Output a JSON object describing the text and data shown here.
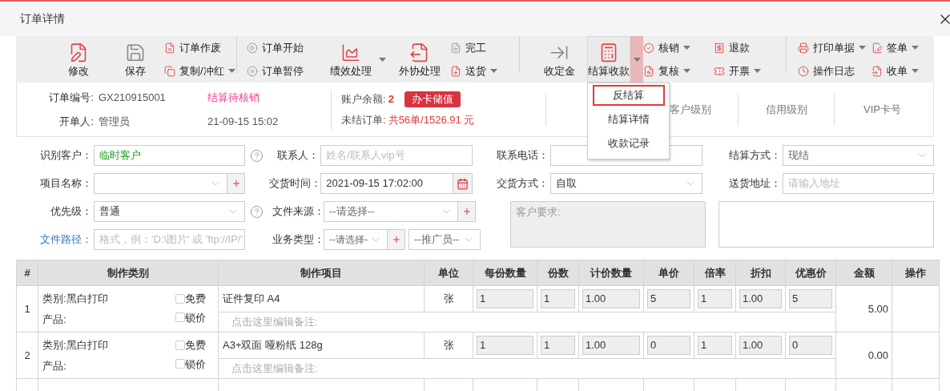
{
  "window": {
    "title": "订单详情"
  },
  "toolbar": {
    "groups": [
      {
        "items": [
          {
            "kind": "large",
            "label": "修改",
            "has_menu": false,
            "pressed": false
          },
          {
            "kind": "large",
            "label": "保存",
            "has_menu": false,
            "pressed": false
          },
          {
            "kind": "stack",
            "items": [
              {
                "label": "订单作废",
                "has_menu": false
              },
              {
                "label": "复制/冲红",
                "has_menu": true
              }
            ]
          }
        ]
      },
      {
        "items": [
          {
            "kind": "stack",
            "items": [
              {
                "label": "订单开始",
                "has_menu": false
              },
              {
                "label": "订单暂停",
                "has_menu": false
              }
            ]
          },
          {
            "kind": "large",
            "label": "绩效处理",
            "has_menu": true,
            "pressed": false
          },
          {
            "kind": "large",
            "label": "外协处理",
            "has_menu": false,
            "pressed": false
          },
          {
            "kind": "stack",
            "items": [
              {
                "label": "完工",
                "has_menu": false
              },
              {
                "label": "送货",
                "has_menu": true
              }
            ]
          }
        ]
      },
      {
        "items": [
          {
            "kind": "large",
            "label": "收定金",
            "has_menu": false,
            "pressed": false
          },
          {
            "kind": "large",
            "label": "结算收款",
            "has_menu": true,
            "pressed": true
          },
          {
            "kind": "stack",
            "items": [
              {
                "label": "核销",
                "has_menu": true
              },
              {
                "label": "复核",
                "has_menu": true
              }
            ]
          },
          {
            "kind": "stack",
            "items": [
              {
                "label": "退款",
                "has_menu": false
              },
              {
                "label": "开票",
                "has_menu": true
              }
            ]
          }
        ]
      },
      {
        "items": [
          {
            "kind": "stack",
            "items": [
              {
                "label": "打印单据",
                "has_menu": true
              },
              {
                "label": "操作日志",
                "has_menu": false
              }
            ]
          },
          {
            "kind": "stack",
            "items": [
              {
                "label": "签单",
                "has_menu": true
              },
              {
                "label": "收单",
                "has_menu": true
              }
            ]
          }
        ]
      }
    ]
  },
  "menu": {
    "items": [
      {
        "label": "反结算",
        "selected": true
      },
      {
        "label": "结算详情",
        "selected": false
      },
      {
        "label": "收款记录",
        "selected": false
      }
    ]
  },
  "info": {
    "order_no": {
      "label": "订单编号:",
      "value": "GX210915001"
    },
    "status": "结算待核销",
    "creator": {
      "label": "开单人:",
      "value": "管理员"
    },
    "created": "21-09-15 15:02",
    "balance": {
      "label": "账户余额:",
      "value": "2"
    },
    "recharge_button": "办卡储值",
    "unpaid": {
      "label": "未结订单:",
      "value": "共56单/1526.91 元"
    },
    "columns": [
      "",
      "客户级别",
      "信用级别",
      "VIP卡号"
    ]
  },
  "form": {
    "rows": [
      [
        {
          "kind": "customer",
          "label": "识别客户：",
          "value": "临时客户",
          "help": true
        },
        {
          "kind": "text",
          "label": "联系人：",
          "placeholder": "姓名/联系人vip号"
        },
        {
          "kind": "text",
          "label": "联系电话："
        },
        {
          "kind": "select",
          "label": "结算方式：",
          "placeholder": "现结"
        }
      ],
      [
        {
          "kind": "select",
          "label": "项目名称：",
          "add": true
        },
        {
          "kind": "date",
          "label": "交货时间：",
          "value": "2021-09-15 17:02:00"
        },
        {
          "kind": "select",
          "label": "交货方式：",
          "value": "自取"
        },
        {
          "kind": "text",
          "label": "送货地址：",
          "placeholder": "请输入地址"
        }
      ]
    ],
    "left_rows": [
      [
        {
          "kind": "select",
          "label": "优先级：",
          "value": "普通",
          "help": true
        },
        {
          "kind": "select",
          "label": "文件来源：",
          "placeholder": "--请选择--",
          "add": true
        }
      ],
      [
        {
          "kind": "text",
          "label": "文件路径：",
          "link": true,
          "placeholder": "格式，例：'D:\\图片' 或 'ftp://IP/'"
        },
        {
          "kind": "select",
          "label": "业务类型：",
          "placeholder": "--请选择-",
          "add": true,
          "extra_placeholder": "--推广员--"
        }
      ]
    ],
    "notes": [
      {
        "placeholder": "客户要求:",
        "readonly": true
      },
      {
        "readonly": false
      }
    ]
  },
  "table": {
    "columns": [
      "#",
      "制作类别",
      "制作项目",
      "单位",
      "每份数量",
      "份数",
      "计价数量",
      "单价",
      "倍率",
      "折扣",
      "优惠价",
      "金额",
      "操作"
    ],
    "rows": [
      {
        "number": "1",
        "category": "类别:黑白打印",
        "product": "产品:",
        "free": {
          "label": "免费",
          "checked": false
        },
        "lock": {
          "label": "锁价",
          "checked": false
        },
        "item": "证件复印 A4",
        "unit": "张",
        "values": [
          "1",
          "1",
          "1.00",
          "5",
          "1",
          "1.00",
          "5"
        ],
        "note": "点击这里编辑备注:",
        "amount": "5.00"
      },
      {
        "number": "2",
        "category": "类别:黑白打印",
        "product": "产品:",
        "free": {
          "label": "免费",
          "checked": false
        },
        "lock": {
          "label": "锁价",
          "checked": false
        },
        "item": "A3+双面 哑粉纸 128g",
        "unit": "张",
        "values": [
          "1",
          "1",
          "1.00",
          "0",
          "1",
          "1.00",
          "0"
        ],
        "note": "点击这里编辑备注:",
        "amount": "0.00"
      }
    ]
  }
}
